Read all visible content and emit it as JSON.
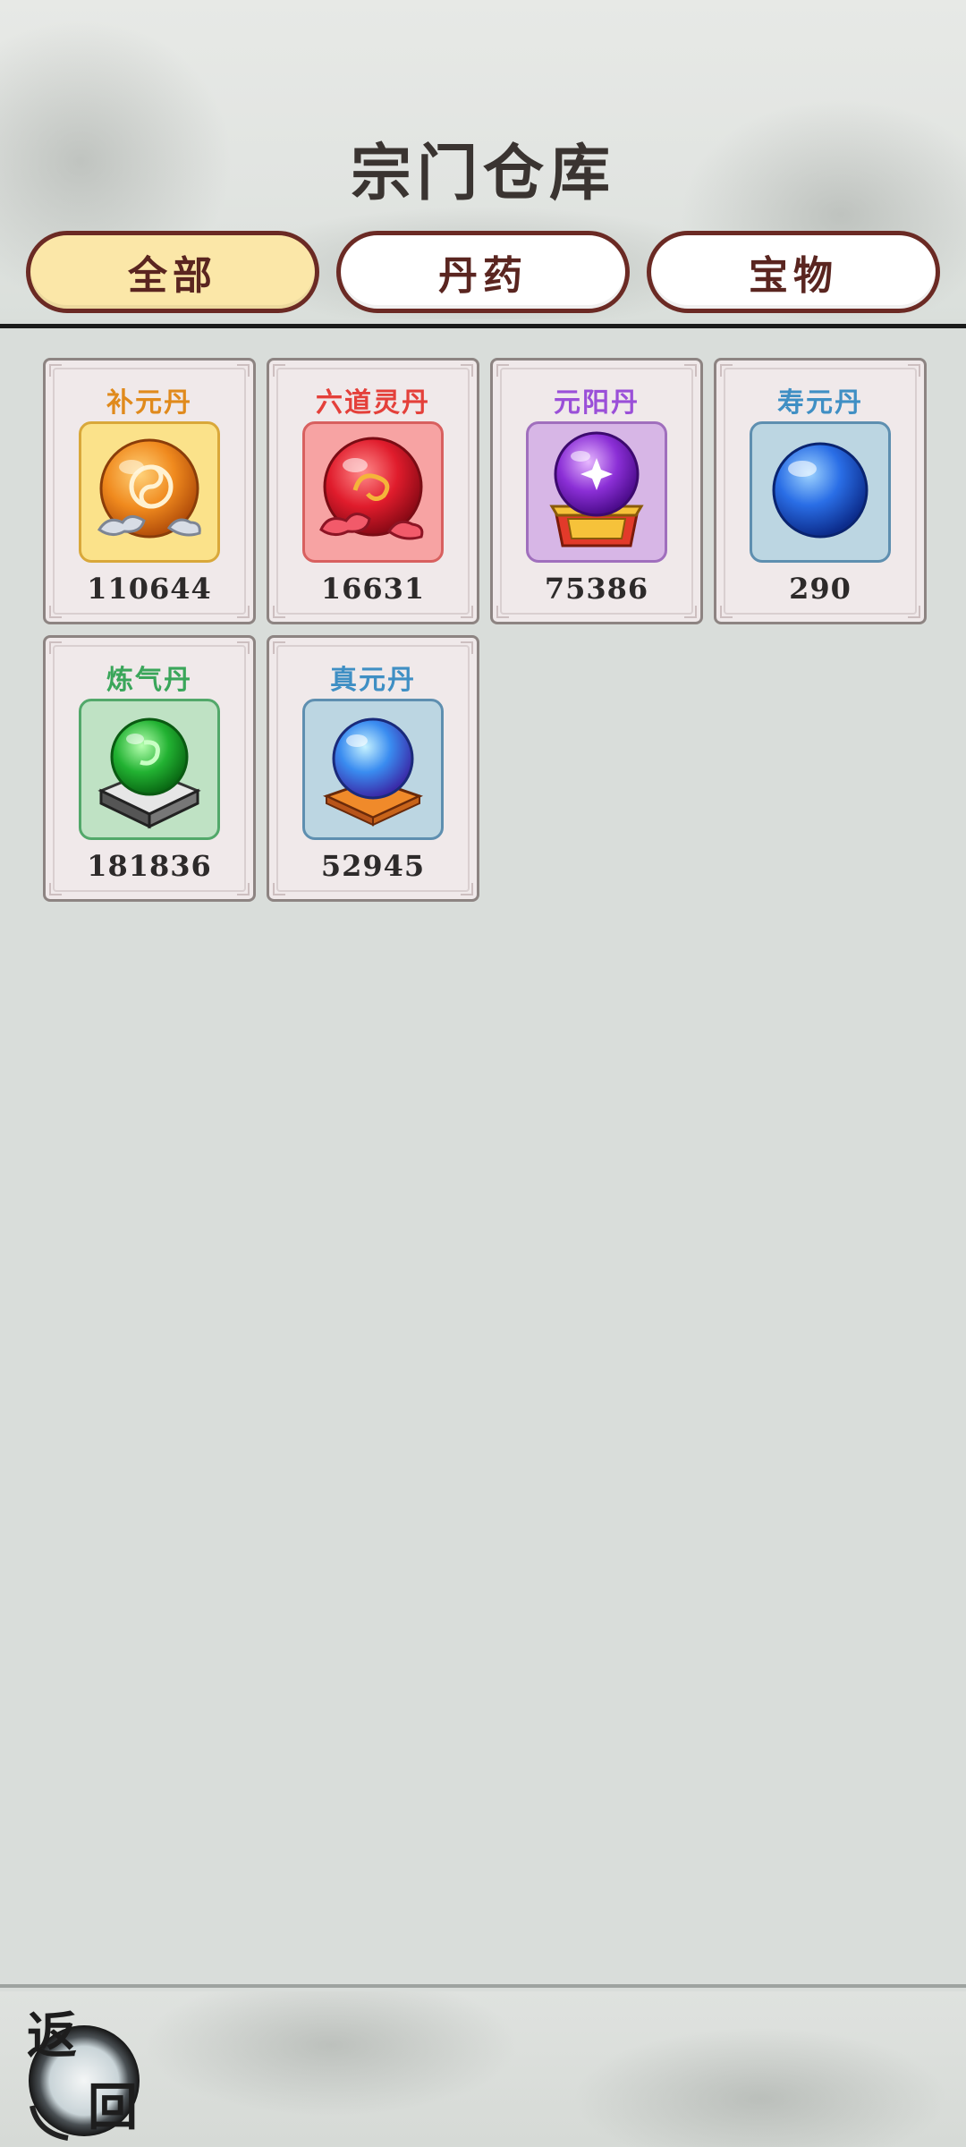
{
  "header": {
    "title": "宗门仓库",
    "tabs": [
      {
        "label": "全部",
        "active": true
      },
      {
        "label": "丹药",
        "active": false
      },
      {
        "label": "宝物",
        "active": false
      }
    ]
  },
  "items": [
    {
      "name": "补元丹",
      "count": "110644",
      "name_color": "#e08a1c",
      "frame_bg": "#fbe28a",
      "frame_border": "#d9a83a",
      "icon": "orange-yin-yang-pill-icon"
    },
    {
      "name": "六道灵丹",
      "count": "16631",
      "name_color": "#e4403a",
      "frame_bg": "#f7a3a3",
      "frame_border": "#d8605f",
      "icon": "red-cloud-pill-icon"
    },
    {
      "name": "元阳丹",
      "count": "75386",
      "name_color": "#9a4fd8",
      "frame_bg": "#d7b6e6",
      "frame_border": "#a06fbd",
      "icon": "purple-star-pill-icon"
    },
    {
      "name": "寿元丹",
      "count": "290",
      "name_color": "#3f8fc4",
      "frame_bg": "#bcd6e2",
      "frame_border": "#5e8fb0",
      "icon": "blue-pill-icon"
    },
    {
      "name": "炼气丹",
      "count": "181836",
      "name_color": "#3aa65a",
      "frame_bg": "#bfe2c4",
      "frame_border": "#52a86a",
      "icon": "green-pill-icon"
    },
    {
      "name": "真元丹",
      "count": "52945",
      "name_color": "#3f8fc4",
      "frame_bg": "#bcd6e2",
      "frame_border": "#5e8fb0",
      "icon": "cyan-pill-icon"
    }
  ],
  "footer": {
    "back_char_1": "返",
    "back_char_2": "回"
  }
}
